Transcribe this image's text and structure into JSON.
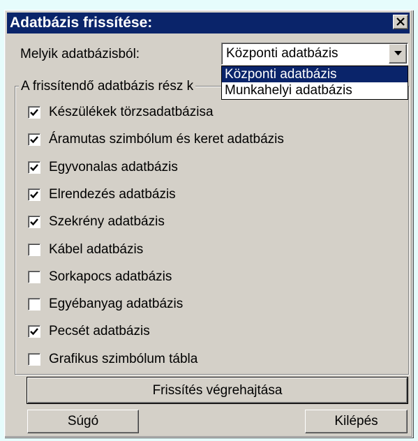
{
  "dialog": {
    "title": "Adatbázis frissítése:"
  },
  "source": {
    "label": "Melyik adatbázisból:",
    "selected": "Központi adatbázis",
    "options": [
      "Központi adatbázis",
      "Munkahelyi adatbázis"
    ]
  },
  "group": {
    "legend": "A frissítendő adatbázis rész k",
    "items": [
      {
        "label": "Készülékek törzsadatbázisa",
        "checked": true
      },
      {
        "label": "Áramutas szimbólum és keret adatbázis",
        "checked": true
      },
      {
        "label": "Egyvonalas adatbázis",
        "checked": true
      },
      {
        "label": "Elrendezés adatbázis",
        "checked": true
      },
      {
        "label": "Szekrény adatbázis",
        "checked": true
      },
      {
        "label": "Kábel adatbázis",
        "checked": false
      },
      {
        "label": "Sorkapocs adatbázis",
        "checked": false
      },
      {
        "label": "Egyébanyag adatbázis",
        "checked": false
      },
      {
        "label": "Pecsét adatbázis",
        "checked": true
      },
      {
        "label": "Grafikus szimbólum tábla",
        "checked": false
      }
    ]
  },
  "buttons": {
    "execute": "Frissítés végrehajtása",
    "help": "Súgó",
    "exit": "Kilépés"
  },
  "colors": {
    "titlebar": "#0a246a",
    "face": "#d4d0c8",
    "selection": "#0a246a"
  }
}
